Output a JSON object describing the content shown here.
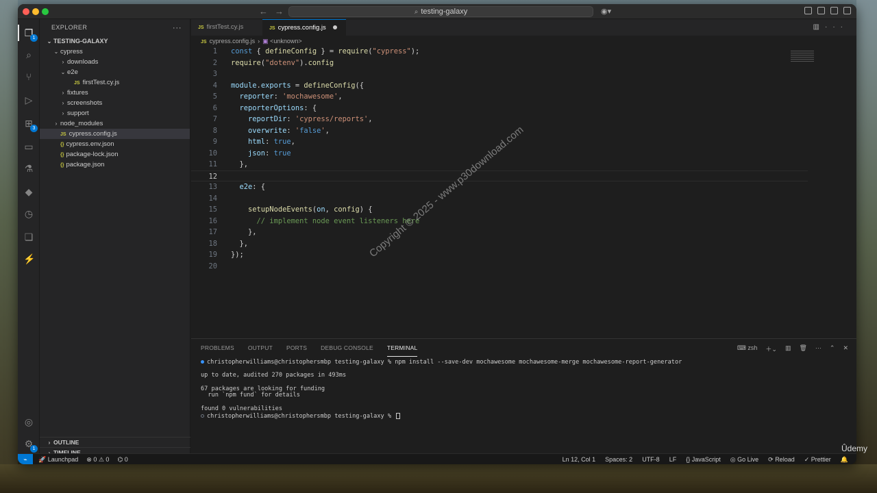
{
  "window": {
    "title": "testing-galaxy",
    "accent": "#0078d4"
  },
  "sidebar": {
    "header": "EXPLORER",
    "root": "TESTING-GALAXY",
    "tree": [
      {
        "label": "cypress",
        "type": "folder",
        "depth": 1,
        "open": true
      },
      {
        "label": "downloads",
        "type": "folder",
        "depth": 2,
        "open": false
      },
      {
        "label": "e2e",
        "type": "folder",
        "depth": 2,
        "open": true
      },
      {
        "label": "firstTest.cy.js",
        "type": "js",
        "depth": 3
      },
      {
        "label": "fixtures",
        "type": "folder",
        "depth": 2,
        "open": false
      },
      {
        "label": "screenshots",
        "type": "folder",
        "depth": 2,
        "open": false
      },
      {
        "label": "support",
        "type": "folder",
        "depth": 2,
        "open": false
      },
      {
        "label": "node_modules",
        "type": "folder",
        "depth": 1,
        "open": false
      },
      {
        "label": "cypress.config.js",
        "type": "js",
        "depth": 1,
        "selected": true
      },
      {
        "label": "cypress.env.json",
        "type": "json",
        "depth": 1
      },
      {
        "label": "package-lock.json",
        "type": "json",
        "depth": 1
      },
      {
        "label": "package.json",
        "type": "json",
        "depth": 1
      }
    ],
    "outline": "OUTLINE",
    "timeline": "TIMELINE",
    "js_badge": "JS",
    "json_badge": "{}"
  },
  "tabs": [
    {
      "label": "firstTest.cy.js",
      "active": false
    },
    {
      "label": "cypress.config.js",
      "active": true,
      "modified": true
    }
  ],
  "breadcrumb": {
    "file": "cypress.config.js",
    "symbol": "<unknown>"
  },
  "code": {
    "current_line": 12,
    "lines": [
      {
        "n": "1",
        "text": "const { defineConfig } = require(\"cypress\");"
      },
      {
        "n": "2",
        "text": "require(\"dotenv\").config"
      },
      {
        "n": "3",
        "text": ""
      },
      {
        "n": "4",
        "text": "module.exports = defineConfig({"
      },
      {
        "n": "5",
        "text": "  reporter: 'mochawesome',"
      },
      {
        "n": "6",
        "text": "  reporterOptions: {"
      },
      {
        "n": "7",
        "text": "    reportDir: 'cypress/reports',"
      },
      {
        "n": "8",
        "text": "    overwrite: 'false',"
      },
      {
        "n": "9",
        "text": "    html: true,"
      },
      {
        "n": "10",
        "text": "    json: true"
      },
      {
        "n": "11",
        "text": "  },"
      },
      {
        "n": "12",
        "text": ""
      },
      {
        "n": "13",
        "text": "  e2e: {"
      },
      {
        "n": "14",
        "text": ""
      },
      {
        "n": "15",
        "text": "    setupNodeEvents(on, config) {"
      },
      {
        "n": "16",
        "text": "      // implement node event listeners here"
      },
      {
        "n": "17",
        "text": "    },"
      },
      {
        "n": "18",
        "text": "  },"
      },
      {
        "n": "19",
        "text": "});"
      },
      {
        "n": "20",
        "text": ""
      }
    ]
  },
  "watermark": "Copyright © 2025 - www.p30download.com",
  "panel": {
    "tabs": [
      "PROBLEMS",
      "OUTPUT",
      "PORTS",
      "DEBUG CONSOLE",
      "TERMINAL"
    ],
    "active_tab": "TERMINAL",
    "shell": "zsh",
    "terminal_lines": [
      "christopherwilliams@christophersmbp testing-galaxy % npm install --save-dev mochawesome mochawesome-merge mochawesome-report-generator",
      "",
      "up to date, audited 270 packages in 493ms",
      "",
      "67 packages are looking for funding",
      "  run `npm fund` for details",
      "",
      "found 0 vulnerabilities",
      "christopherwilliams@christophersmbp testing-galaxy % "
    ]
  },
  "statusbar": {
    "launchpad": "Launchpad",
    "errors": "0",
    "warnings": "0",
    "ports": "0",
    "position": "Ln 12, Col 1",
    "spaces": "Spaces: 2",
    "encoding": "UTF-8",
    "eol": "LF",
    "language": "JavaScript",
    "live": "Go Live",
    "reload": "Reload",
    "prettier": "Prettier"
  },
  "brand": "Ûdemy"
}
